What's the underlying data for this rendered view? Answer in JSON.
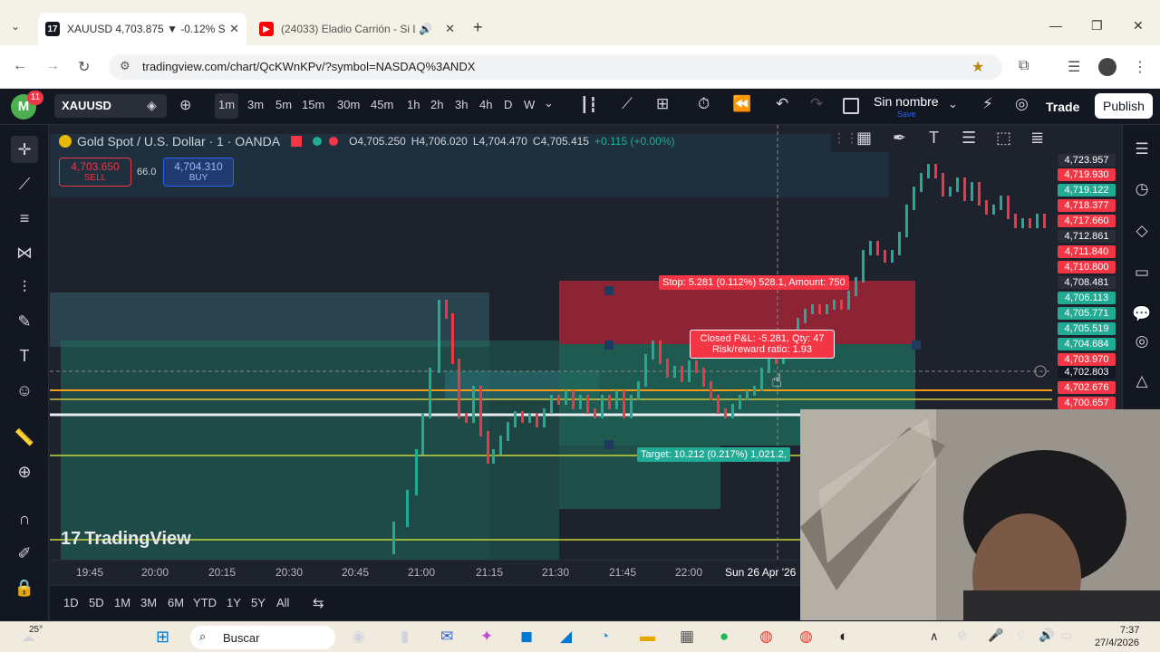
{
  "browser": {
    "tabs": [
      {
        "title": "XAUUSD 4,703.875 ▼ -0.12% S",
        "favicon": "tradingview-icon"
      },
      {
        "title": "(24033) Eladio Carrión - Si L",
        "favicon": "youtube-icon"
      }
    ],
    "url": "tradingview.com/chart/QcKWnKPv/?symbol=NASDAQ%3ANDX"
  },
  "toolbar": {
    "avatar_letter": "M",
    "notif_count": "11",
    "symbol": "XAUUSD",
    "timeframes": [
      "1m",
      "3m",
      "5m",
      "15m",
      "30m",
      "45m",
      "1h",
      "2h",
      "3h",
      "4h",
      "D",
      "W"
    ],
    "layout_name": "Sin nombre",
    "layout_sub": "Save",
    "trade_label": "Trade",
    "publish_label": "Publish"
  },
  "legend": {
    "title": "Gold Spot / U.S. Dollar · 1 · OANDA",
    "open": "O4,705.250",
    "high": "H4,706.020",
    "low": "L4,704.470",
    "close": "C4,705.415",
    "change": "+0.115 (+0.00%)",
    "sell_price": "4,703.650",
    "sell_label": "SELL",
    "spread": "66.0",
    "buy_price": "4,704.310",
    "buy_label": "BUY"
  },
  "position": {
    "stop_label": "Stop: 5.281 (0.112%) 528.1, Amount: 750",
    "pnl_line1": "Closed P&L: -5.281, Qty: 47",
    "pnl_line2": "Risk/reward ratio: 1.93",
    "target_label": "Target: 10.212 (0.217%) 1,021.2,"
  },
  "watermark": "TradingView",
  "price_scale": [
    {
      "label": "4,723.957",
      "color": "#2a2e39"
    },
    {
      "label": "4,719.930",
      "color": "#f23645"
    },
    {
      "label": "4,719.122",
      "color": "#22ab94"
    },
    {
      "label": "4,718.377",
      "color": "#f23645"
    },
    {
      "label": "4,717.660",
      "color": "#f23645"
    },
    {
      "label": "4,712.861",
      "color": "#2a2e39"
    },
    {
      "label": "4,711.840",
      "color": "#f23645"
    },
    {
      "label": "4,710.800",
      "color": "#f23645"
    },
    {
      "label": "4,708.481",
      "color": "#2a2e39"
    },
    {
      "label": "4,706.113",
      "color": "#22ab94"
    },
    {
      "label": "4,705.771",
      "color": "#22ab94"
    },
    {
      "label": "4,705.519",
      "color": "#22ab94"
    },
    {
      "label": "4,704.684",
      "color": "#22ab94"
    },
    {
      "label": "4,703.970",
      "color": "#f23645"
    },
    {
      "label": "4,702.803",
      "color": "#131722"
    },
    {
      "label": "4,702.676",
      "color": "#f23645"
    },
    {
      "label": "4,700.657",
      "color": "#f23645"
    }
  ],
  "time_axis": [
    "19:45",
    "20:00",
    "20:15",
    "20:30",
    "20:45",
    "21:00",
    "21:15",
    "21:30",
    "21:45",
    "22:00",
    "Sun 26 Apr '26"
  ],
  "ranges": [
    "1D",
    "5D",
    "1M",
    "3M",
    "6M",
    "YTD",
    "1Y",
    "5Y",
    "All"
  ],
  "taskbar": {
    "weather": "25°",
    "search_placeholder": "Buscar",
    "time": "7:37",
    "date": "27/4/2026"
  }
}
